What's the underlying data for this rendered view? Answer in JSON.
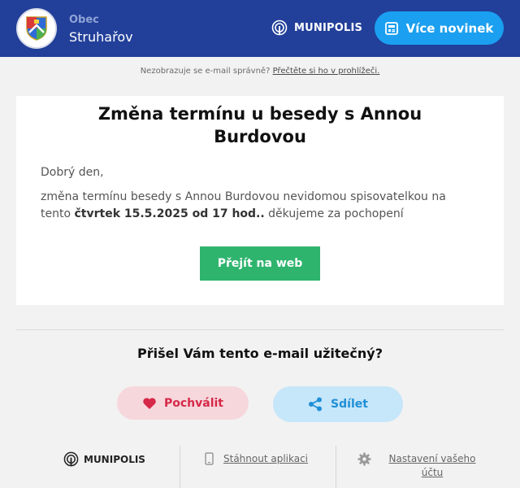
{
  "header": {
    "town_prefix": "Obec",
    "town_name": "Struhařov",
    "brand": "MUNIPOLIS",
    "more_news_label": "Více novinek",
    "colors": {
      "background": "#22409a",
      "button": "#1b9ff0"
    }
  },
  "notice": {
    "text": "Nezobrazuje se e-mail správně?",
    "link": "Přečtěte si ho v prohlížeči."
  },
  "article": {
    "title": "Změna termínu u besedy s Annou Burdovou",
    "greeting": "Dobrý den,",
    "body_start": "změna termínu besedy s Annou Burdovou nevidomou spisovatelkou na tento",
    "body_bold": "čtvrtek 15.5.2025  od 17 hod..",
    "body_end": "děkujeme za pochopení",
    "button_label": "Přejít na web",
    "button_color": "#2fb46e"
  },
  "feedback": {
    "question": "Přišel Vám tento e-mail užitečný?",
    "praise_label": "Pochválit",
    "share_label": "Sdílet",
    "icons": [
      "heart-icon",
      "share-icon"
    ]
  },
  "footer": {
    "brand": "MUNIPOLIS",
    "app_label": "Stáhnout aplikaci",
    "settings_label": "Nastavení vašeho účtu",
    "icons": [
      "munipolis-logo-icon",
      "phone-icon",
      "gear-icon"
    ]
  }
}
